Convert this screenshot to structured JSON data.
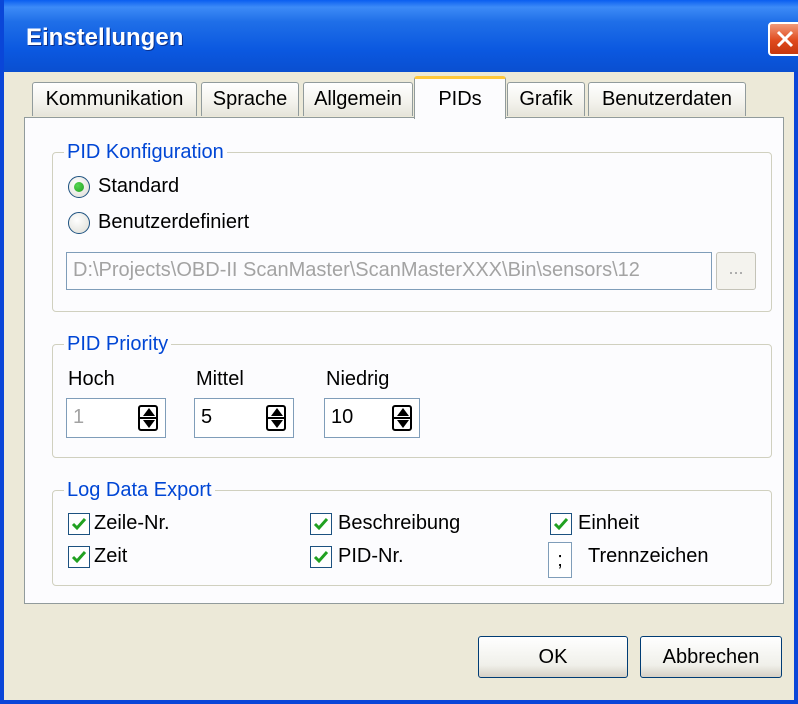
{
  "window": {
    "title": "Einstellungen"
  },
  "tabs": [
    {
      "label": "Kommunikation"
    },
    {
      "label": "Sprache"
    },
    {
      "label": "Allgemein"
    },
    {
      "label": "PIDs"
    },
    {
      "label": "Grafik"
    },
    {
      "label": "Benutzerdaten"
    }
  ],
  "active_tab": "PIDs",
  "pid_config": {
    "group_label": "PID Konfiguration",
    "options": [
      {
        "label": "Standard",
        "selected": true
      },
      {
        "label": "Benutzerdefiniert",
        "selected": false
      }
    ],
    "path_value": "D:\\Projects\\OBD-II ScanMaster\\ScanMasterXXX\\Bin\\sensors\\12",
    "browse_label": "..."
  },
  "pid_priority": {
    "group_label": "PID Priority",
    "fields": [
      {
        "label": "Hoch",
        "value": "1",
        "enabled": false
      },
      {
        "label": "Mittel",
        "value": "5",
        "enabled": true
      },
      {
        "label": "Niedrig",
        "value": "10",
        "enabled": true
      }
    ]
  },
  "log_export": {
    "group_label": "Log Data Export",
    "checkboxes": [
      {
        "label": "Zeile-Nr.",
        "checked": true
      },
      {
        "label": "Zeit",
        "checked": true
      },
      {
        "label": "Beschreibung",
        "checked": true
      },
      {
        "label": "PID-Nr.",
        "checked": true
      },
      {
        "label": "Einheit",
        "checked": true
      }
    ],
    "separator": {
      "value": ";",
      "label": "Trennzeichen"
    }
  },
  "buttons": {
    "ok": "OK",
    "cancel": "Abbrechen"
  },
  "colors": {
    "title_bar": "#0a5ef0",
    "group_label": "#0046d5",
    "tab_highlight": "#ffc83c",
    "close": "#e04a1d"
  }
}
